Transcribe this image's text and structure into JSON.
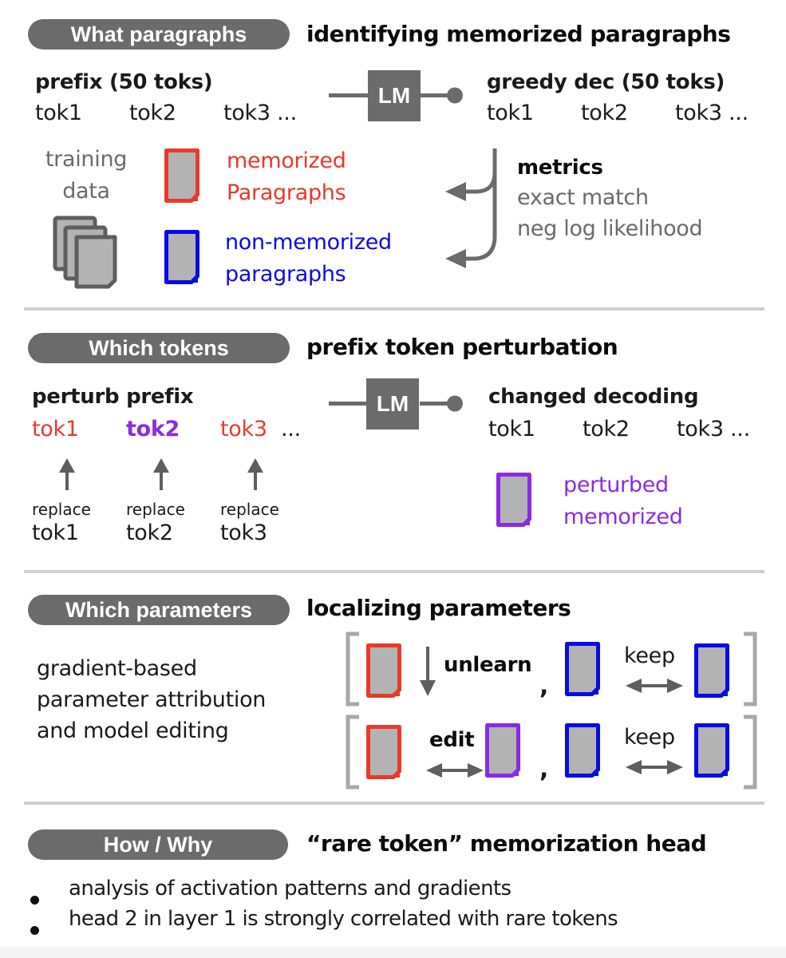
{
  "sections": [
    {
      "pill": "What paragraphs",
      "heading": "identifying memorized paragraphs",
      "input_label": "prefix (50 toks)",
      "input_tokens": [
        "tok1",
        "tok2",
        "tok3 ..."
      ],
      "model": "LM",
      "output_label": "greedy dec (50 toks)",
      "output_tokens": [
        "tok1",
        "tok2",
        "tok3 ..."
      ],
      "source_label": [
        "training",
        "data"
      ],
      "memorized_label": [
        "memorized",
        "Paragraphs"
      ],
      "non_memorized_label": [
        "non-memorized",
        "paragraphs"
      ],
      "metrics_title": "metrics",
      "metrics": [
        "exact match",
        "neg log likelihood"
      ]
    },
    {
      "pill": "Which tokens",
      "heading": "prefix token perturbation",
      "input_label": "perturb prefix",
      "input_tokens": [
        "tok1",
        "tok2",
        "tok3"
      ],
      "ellipsis": "...",
      "model": "LM",
      "output_label": "changed decoding",
      "output_tokens": [
        "tok1",
        "tok2",
        "tok3 ..."
      ],
      "replace_label": "replace",
      "replace_tokens": [
        "tok1",
        "tok2",
        "tok3"
      ],
      "perturbed_label": [
        "perturbed",
        "memorized"
      ]
    },
    {
      "pill": "Which parameters",
      "heading": "localizing parameters",
      "description": [
        "gradient-based",
        "parameter attribution",
        "and model editing"
      ],
      "row1": {
        "action": "unlearn",
        "keep": "keep"
      },
      "row2": {
        "action": "edit",
        "keep": "keep"
      },
      "separator": ","
    },
    {
      "pill": "How / Why",
      "heading": "“rare token” memorization head",
      "bullets": [
        "analysis of activation patterns and gradients",
        "head 2 in layer 1 is strongly correlated with rare tokens"
      ]
    }
  ],
  "colors": {
    "memorized": "#e8392b",
    "non_memorized": "#0a0ae6",
    "perturbed": "#8a2be2",
    "neutral": "#6b6b6b",
    "doc_fill": "#b3b3b3",
    "divider": "#cfcfcf"
  }
}
